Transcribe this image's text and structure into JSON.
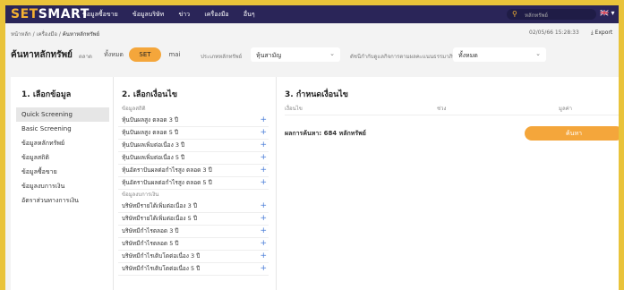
{
  "header": {
    "logo_set": "SET",
    "logo_smart": "SMART",
    "nav": [
      "ข้อมูลซื้อขาย",
      "ข้อมูลบริษัท",
      "ข่าว",
      "เครื่องมือ",
      "อื่นๆ"
    ],
    "search_placeholder": "หลักทรัพย์",
    "flag": "🇬🇧 ▾"
  },
  "breadcrumb": {
    "home": "หน้าหลัก",
    "tools": "เครื่องมือ",
    "current": "ค้นหาหลักทรัพย์",
    "sep": " / "
  },
  "datetime": "02/05/66 15:28:33",
  "export_label": "⤓ Export",
  "page_title": "ค้นหาหลักทรัพย์",
  "market": {
    "label": "ตลาด",
    "options": [
      "ทั้งหมด",
      "SET",
      "mai"
    ],
    "selected": "SET"
  },
  "stock_type": {
    "label": "ประเภทหลักทรัพย์",
    "value": "หุ้นสามัญ"
  },
  "cg": {
    "label": "ดัชนีกำกับดูแลกิจการตามผลคะแนนธรรมาภิบาล",
    "value": "ทั้งหมด"
  },
  "step1": {
    "title": "1. เลือกข้อมูล",
    "items": [
      "Quick Screening",
      "Basic Screening",
      "ข้อมูลหลักทรัพย์",
      "ข้อมูลสถิติ",
      "ข้อมูลซื้อขาย",
      "ข้อมูลงบการเงิน",
      "อัตราส่วนทางการเงิน"
    ],
    "active_index": 0
  },
  "step2": {
    "title": "2. เลือกเงื่อนไข",
    "sections": [
      {
        "name": "ข้อมูลสถิติ",
        "items": [
          "หุ้นปันผลสูง ตลอด 3 ปี",
          "หุ้นปันผลสูง ตลอด 5 ปี",
          "หุ้นปันผลเพิ่มต่อเนื่อง 3 ปี",
          "หุ้นปันผลเพิ่มต่อเนื่อง 5 ปี",
          "หุ้นอัตราปันผลต่อกำไรสูง ตลอด 3 ปี",
          "หุ้นอัตราปันผลต่อกำไรสูง ตลอด 5 ปี"
        ]
      },
      {
        "name": "ข้อมูลงบการเงิน",
        "items": [
          "บริษัทมีรายได้เพิ่มต่อเนื่อง 3 ปี",
          "บริษัทมีรายได้เพิ่มต่อเนื่อง 5 ปี",
          "บริษัทมีกำไรตลอด 3 ปี",
          "บริษัทมีกำไรตลอด 5 ปี",
          "บริษัทมีกำไรเติบโตต่อเนื่อง 3 ปี",
          "บริษัทมีกำไรเติบโตต่อเนื่อง 5 ปี"
        ]
      }
    ],
    "plus": "+"
  },
  "step3": {
    "title": "3. กำหนดเงื่อนไข",
    "col_condition": "เงื่อนไข",
    "col_range": "ช่วง",
    "col_value": "มูลค่า",
    "result": "ผลการค้นหา: 684 หลักทรัพย์",
    "search_button": "ค้นหา"
  }
}
